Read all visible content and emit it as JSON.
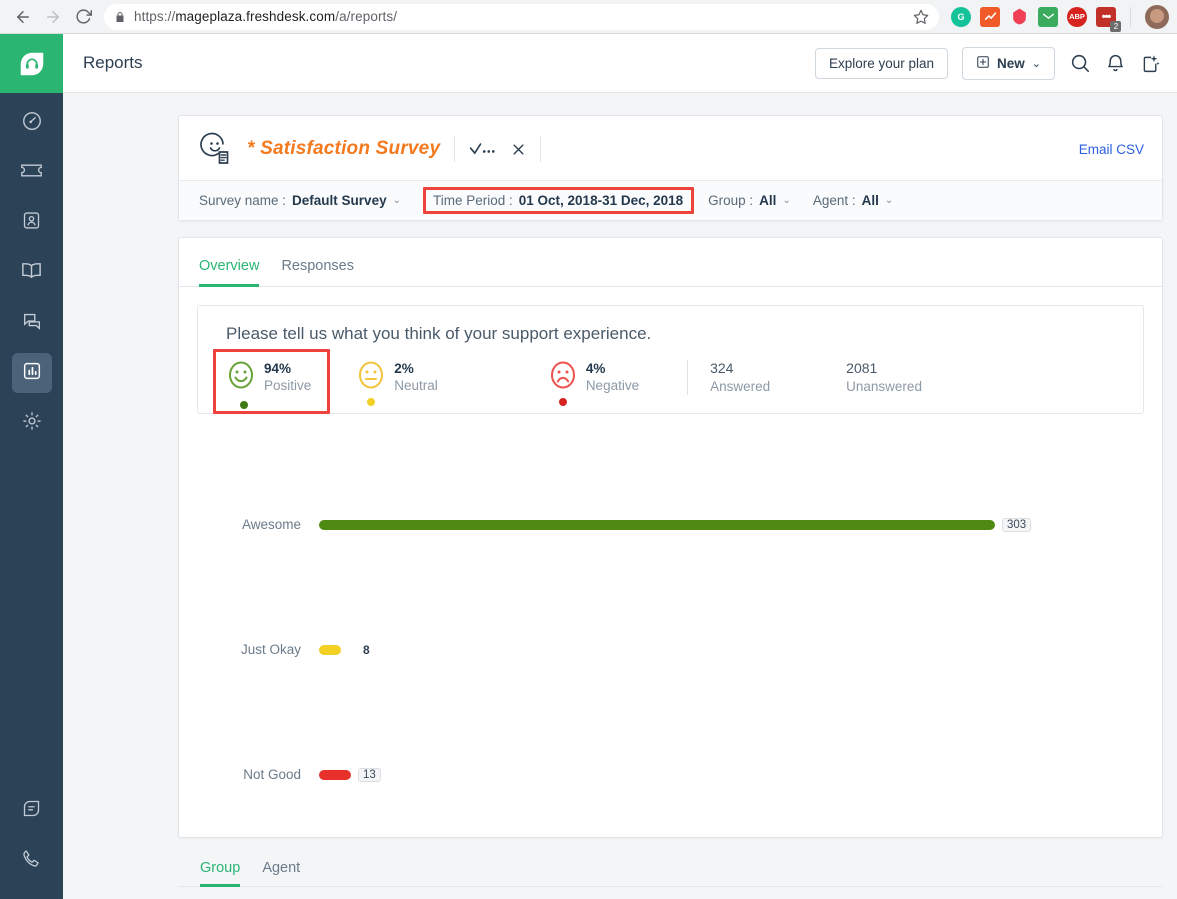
{
  "browser": {
    "url_scheme": "https://",
    "url_main": "mageplaza.freshdesk.com",
    "url_path": "/a/reports/",
    "back_icon": "back-arrow-icon",
    "forward_icon": "forward-arrow-icon",
    "reload_icon": "reload-icon",
    "lock_icon": "lock-icon",
    "star_icon": "star-icon",
    "extensions": [
      {
        "name": "grammarly-extension",
        "glyph": "G",
        "color": "#15c39a",
        "badge": ""
      },
      {
        "name": "analytics-extension",
        "glyph": "",
        "color": "#f05a28",
        "badge": ""
      },
      {
        "name": "pocket-extension",
        "glyph": "",
        "color": "#ef4056",
        "badge": ""
      },
      {
        "name": "mail-checker-extension",
        "glyph": "",
        "color": "#34a853",
        "badge": ""
      },
      {
        "name": "adblock-plus-extension",
        "glyph": "ABP",
        "color": "#d6231f",
        "badge": ""
      },
      {
        "name": "notes-extension",
        "glyph": "",
        "color": "#c2302a",
        "badge": "2"
      }
    ]
  },
  "sidebar": {
    "brand_icon": "headset-logo-icon",
    "items": [
      {
        "name": "dashboard",
        "icon": "speedometer-icon",
        "active": false
      },
      {
        "name": "tickets",
        "icon": "ticket-icon",
        "active": false
      },
      {
        "name": "contacts",
        "icon": "contact-card-icon",
        "active": false
      },
      {
        "name": "solutions",
        "icon": "book-icon",
        "active": false
      },
      {
        "name": "forums",
        "icon": "chat-bubbles-icon",
        "active": false
      },
      {
        "name": "reports",
        "icon": "bar-chart-icon",
        "active": true
      },
      {
        "name": "admin",
        "icon": "gear-icon",
        "active": false
      }
    ],
    "bottom_items": [
      {
        "name": "chat",
        "icon": "speech-tag-icon"
      },
      {
        "name": "phone",
        "icon": "phone-icon"
      }
    ]
  },
  "topbar": {
    "title": "Reports",
    "explore_plan_label": "Explore your plan",
    "new_label": "New",
    "new_icon": "plus-box-icon",
    "new_caret": "⌄",
    "search_icon": "search-icon",
    "notification_icon": "bell-icon",
    "sparkle_icon": "sparkle-icon"
  },
  "survey": {
    "emoji_icon": "smiley-document-icon",
    "title": "* Satisfaction Survey",
    "check_icon": "check-ellipsis-icon",
    "close_icon": "close-x-icon",
    "email_csv_label": "Email CSV",
    "filters": [
      {
        "name": "survey-name",
        "label": "Survey name :",
        "value": "Default Survey",
        "caret": "⌄",
        "highlighted": false
      },
      {
        "name": "time-period",
        "label": "Time Period :",
        "value": "01 Oct, 2018-31 Dec, 2018",
        "caret": "",
        "highlighted": true
      },
      {
        "name": "group",
        "label": "Group :",
        "value": "All",
        "caret": "⌄",
        "highlighted": false
      },
      {
        "name": "agent",
        "label": "Agent :",
        "value": "All",
        "caret": "⌄",
        "highlighted": false
      }
    ]
  },
  "report": {
    "tabs": [
      {
        "name": "tab-overview",
        "label": "Overview",
        "active": true
      },
      {
        "name": "tab-responses",
        "label": "Responses",
        "active": false
      }
    ],
    "question": "Please tell us what you think of your support experience.",
    "stats": [
      {
        "name": "stat-positive",
        "percent": "94%",
        "label": "Positive",
        "color": "#6aa33a",
        "dot": "#3f7a14",
        "highlighted": true
      },
      {
        "name": "stat-neutral",
        "percent": "2%",
        "label": "Neutral",
        "color": "#f2c33c",
        "dot": "#f2d024",
        "highlighted": false
      },
      {
        "name": "stat-negative",
        "percent": "4%",
        "label": "Negative",
        "color": "#ef5350",
        "dot": "#d6231f",
        "highlighted": false
      }
    ],
    "counts": [
      {
        "name": "answered-count",
        "number": "324",
        "label": "Answered",
        "bordered": true
      },
      {
        "name": "unanswered-count",
        "number": "2081",
        "label": "Unanswered",
        "bordered": false
      }
    ],
    "bottom_tabs": [
      {
        "name": "tab-group",
        "label": "Group",
        "active": true
      },
      {
        "name": "tab-agent",
        "label": "Agent",
        "active": false
      }
    ]
  },
  "chart_data": {
    "type": "bar",
    "title": "Please tell us what you think of your support experience.",
    "categories": [
      "Awesome",
      "Just Okay",
      "Not Good"
    ],
    "values": [
      303,
      8,
      13
    ],
    "colors": [
      "#4f8a13",
      "#f2d024",
      "#e8312a"
    ],
    "value_chip": [
      true,
      false,
      true
    ],
    "orientation": "horizontal",
    "xlabel": "",
    "ylabel": "",
    "xlim": [
      0,
      303
    ],
    "grid": false,
    "legend": "none"
  }
}
